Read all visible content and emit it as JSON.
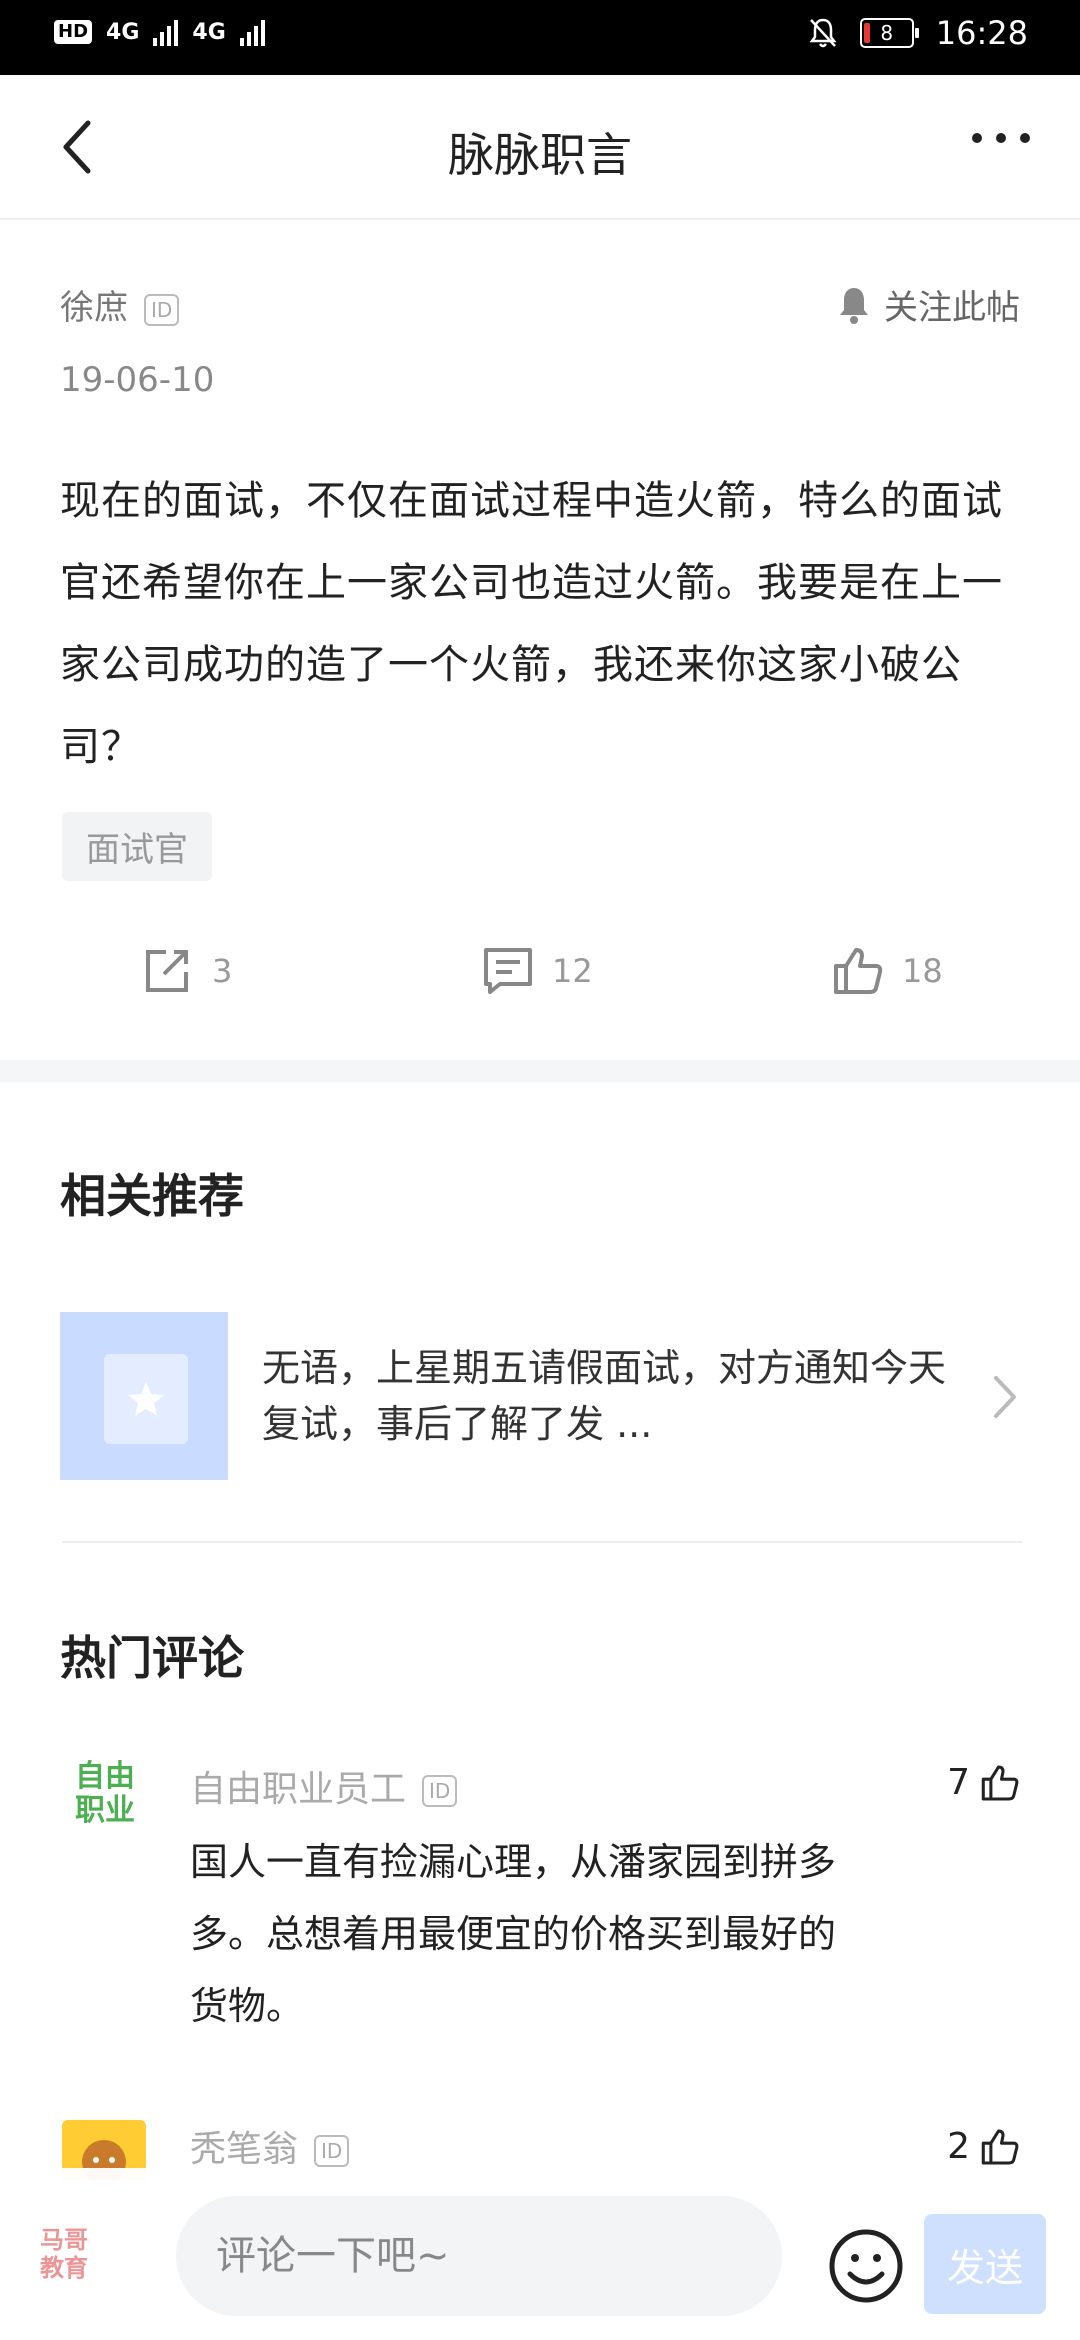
{
  "status_bar": {
    "network_left": "4G",
    "network_right": "4G",
    "battery": "8",
    "time": "16:28",
    "hd": "HD"
  },
  "nav": {
    "title": "脉脉职言"
  },
  "post": {
    "author": "徐庶",
    "id_badge": "ID",
    "follow_label": "关注此帖",
    "date": "19-06-10",
    "content": "现在的面试，不仅在面试过程中造火箭，特么的面试官还希望你在上一家公司也造过火箭。我要是在上一家公司成功的造了一个火箭，我还来你这家小破公司？",
    "tag": "面试官",
    "share_count": "3",
    "comment_count": "12",
    "like_count": "18"
  },
  "related": {
    "title": "相关推荐",
    "item_text": "无语，上星期五请假面试，对方通知今天复试，事后了解了发 ..."
  },
  "hot_comments": {
    "title": "热门评论",
    "items": [
      {
        "avatar_text": "自由职业",
        "name": "自由职业员工",
        "id_badge": "ID",
        "likes": "7",
        "text": "国人一直有捡漏心理，从潘家园到拼多多。总想着用最便宜的价格买到最好的货物。"
      },
      {
        "name": "秃笔翁",
        "id_badge": "ID",
        "likes": "2"
      }
    ]
  },
  "bottom": {
    "placeholder": "评论一下吧~",
    "send_label": "发送",
    "watermark": "马哥教育"
  },
  "icons": [
    "back-icon",
    "more-icon",
    "bell-icon",
    "share-icon",
    "comment-icon",
    "thumbs-up-icon",
    "chevron-right-icon",
    "emoji-icon"
  ]
}
